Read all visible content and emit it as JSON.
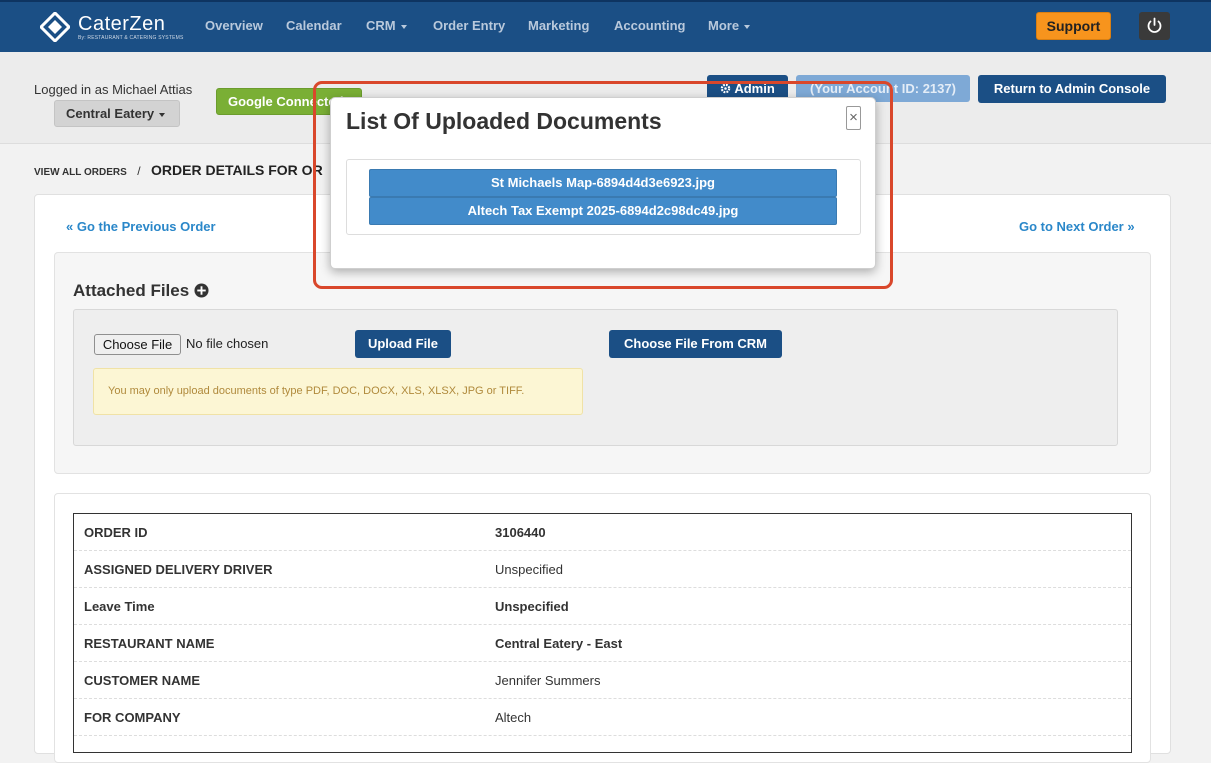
{
  "brand": {
    "name": "CaterZen",
    "tagline": "By: RESTAURANT & CATERING SYSTEMS"
  },
  "nav": {
    "items": [
      {
        "label": "Overview"
      },
      {
        "label": "Calendar"
      },
      {
        "label": "CRM"
      },
      {
        "label": "Order Entry"
      },
      {
        "label": "Marketing"
      },
      {
        "label": "Accounting"
      },
      {
        "label": "More"
      }
    ],
    "support_label": "Support"
  },
  "header": {
    "logged_in_text": "Logged in as Michael Attias",
    "restaurant_selected": "Central Eatery",
    "google_label": "Google Connected",
    "admin_label": "Admin",
    "account_id_text": "(Your Account ID: 2137)",
    "return_label": "Return to Admin Console"
  },
  "breadcrumb": {
    "link": "VIEW ALL ORDERS",
    "separator": "/",
    "current": "ORDER DETAILS FOR OR"
  },
  "order_nav": {
    "prev_label": "« Go the Previous Order",
    "next_label": "Go to Next Order »"
  },
  "files": {
    "title": "Attached Files",
    "choose_file_label": "Choose File",
    "no_file_text": "No file chosen",
    "upload_label": "Upload File",
    "crm_label": "Choose File From CRM",
    "notice": "You may only upload documents of type PDF, DOC, DOCX, XLS, XLSX, JPG or TIFF."
  },
  "details": {
    "rows": [
      {
        "label": "ORDER ID",
        "value": "3106440"
      },
      {
        "label": "ASSIGNED DELIVERY DRIVER",
        "value": "Unspecified"
      },
      {
        "label": "Leave Time",
        "value": "Unspecified"
      },
      {
        "label": "RESTAURANT NAME",
        "value": "Central Eatery - East"
      },
      {
        "label": "CUSTOMER NAME",
        "value": "Jennifer Summers"
      },
      {
        "label": "FOR COMPANY",
        "value": "Altech"
      }
    ]
  },
  "modal": {
    "title": "List Of Uploaded Documents",
    "close_symbol": "×",
    "documents": [
      {
        "name": "St Michaels Map-6894d4d3e6923.jpg"
      },
      {
        "name": "Altech Tax Exempt 2025-6894d2c98dc49.jpg"
      }
    ]
  },
  "colors": {
    "nav_bg": "#1b4f85",
    "support": "#f7941d",
    "google": "#7aaf35",
    "link": "#2a87c9",
    "doc_button": "#428bca",
    "highlight": "#d9472b",
    "notice_bg": "#fcf6d4"
  },
  "icons": [
    "caterzen-logo-icon",
    "caret-down-icon",
    "power-icon",
    "gear-icon",
    "plus-circle-icon",
    "close-icon"
  ]
}
